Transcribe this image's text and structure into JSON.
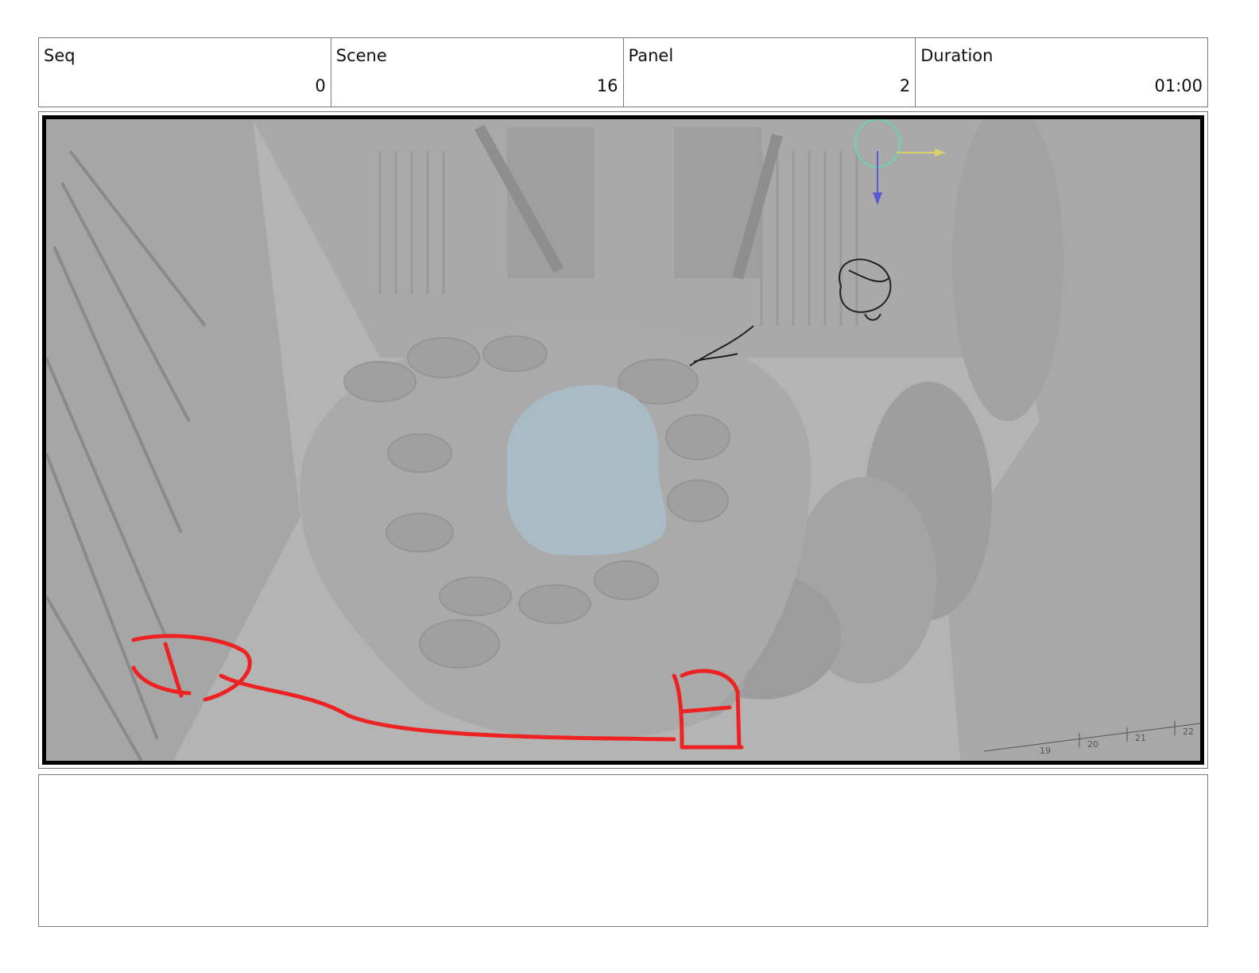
{
  "header": {
    "seq": {
      "label": "Seq",
      "value": "0"
    },
    "scene": {
      "label": "Scene",
      "value": "16"
    },
    "panel": {
      "label": "Panel",
      "value": "2"
    },
    "duration": {
      "label": "Duration",
      "value": "01:00"
    }
  },
  "viewport": {
    "ruler_ticks": [
      "19",
      "20",
      "21",
      "22"
    ],
    "colors": {
      "scene_gray": "#b5b5b5",
      "water": "#a9bcc6",
      "sketch_red": "#ee2222"
    }
  },
  "notes": {
    "text": ""
  }
}
